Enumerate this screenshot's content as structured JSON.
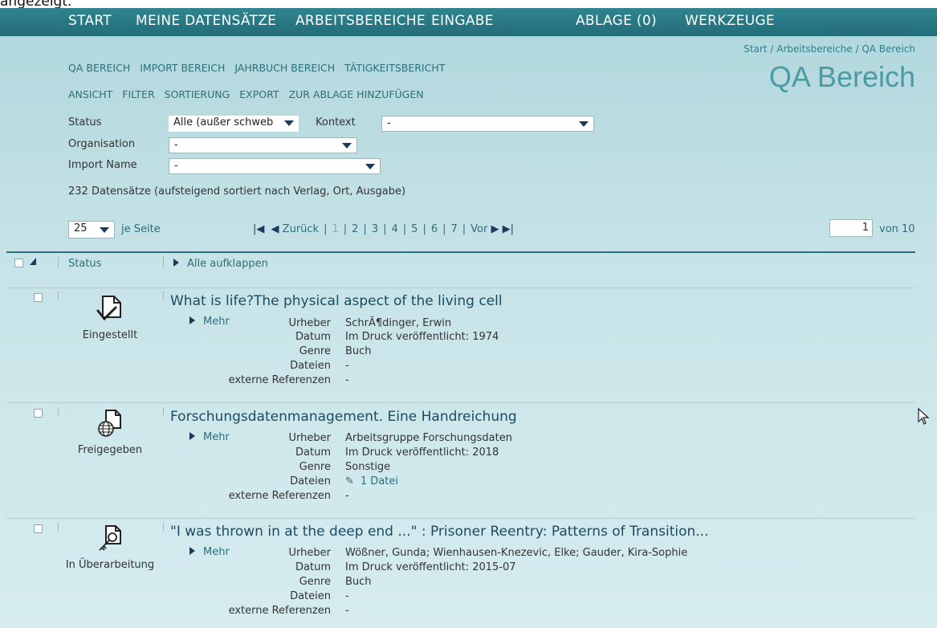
{
  "top_fragment": "angezeigt.",
  "nav": [
    "START",
    "MEINE DATENSÄTZE",
    "ARBEITSBEREICHE",
    "EINGABE",
    "ABLAGE (0)",
    "WERKZEUGE"
  ],
  "breadcrumb": {
    "start": "Start",
    "sep": " / ",
    "area": "Arbeitsbereiche",
    "current": "QA Bereich"
  },
  "page_title": "QA Bereich",
  "subnav1": [
    "QA BEREICH",
    "IMPORT BEREICH",
    "JAHRBUCH BEREICH",
    "TÄTIGKEITSBERICHT"
  ],
  "subnav2": [
    "ANSICHT",
    "FILTER",
    "SORTIERUNG",
    "EXPORT",
    "ZUR ABLAGE HINZUFÜGEN"
  ],
  "filters": {
    "status_label": "Status",
    "status_value": "Alle (außer schweb",
    "kontext_label": "Kontext",
    "kontext_value": "-",
    "organisation_label": "Organisation",
    "organisation_value": "-",
    "import_label": "Import Name",
    "import_value": "-"
  },
  "count_text": "232 Datensätze (aufsteigend sortiert nach Verlag, Ort, Ausgabe)",
  "paging": {
    "per_page": "25",
    "per_page_label": "je Seite",
    "prev": "Zurück",
    "next": "Vor",
    "pages": [
      "1",
      "2",
      "3",
      "4",
      "5",
      "6",
      "7"
    ],
    "current_page": "1",
    "total_label": "von 10"
  },
  "columns": {
    "status": "Status",
    "expand_all": "Alle aufklappen"
  },
  "labels": {
    "mehr": "Mehr",
    "urheber": "Urheber",
    "datum": "Datum",
    "genre": "Genre",
    "dateien": "Dateien",
    "refs": "externe Referenzen"
  },
  "records": [
    {
      "status": "Eingestellt",
      "status_icon": "doc-check-icon",
      "title": "What is life?The physical aspect of the living cell",
      "urheber": "SchrÃ¶dinger, Erwin",
      "datum": "Im Druck veröffentlicht: 1974",
      "genre": "Buch",
      "dateien": "-",
      "refs": "-"
    },
    {
      "status": "Freigegeben",
      "status_icon": "doc-globe-icon",
      "title": "Forschungsdatenmanagement. Eine Handreichung",
      "urheber": "Arbeitsgruppe Forschungsdaten",
      "datum": "Im Druck veröffentlicht: 2018",
      "genre": "Sonstige",
      "dateien": "1 Datei",
      "refs": "-"
    },
    {
      "status": "In Überarbeitung",
      "status_icon": "doc-key-icon",
      "title": "\"I was thrown in at the deep end ...\" : Prisoner Reentry: Patterns of Transition...",
      "urheber": "Wößner, Gunda; Wienhausen-Knezevic, Elke; Gauder, Kira-Sophie",
      "datum": "Im Druck veröffentlicht: 2015-07",
      "genre": "Buch",
      "dateien": "-",
      "refs": "-"
    }
  ]
}
